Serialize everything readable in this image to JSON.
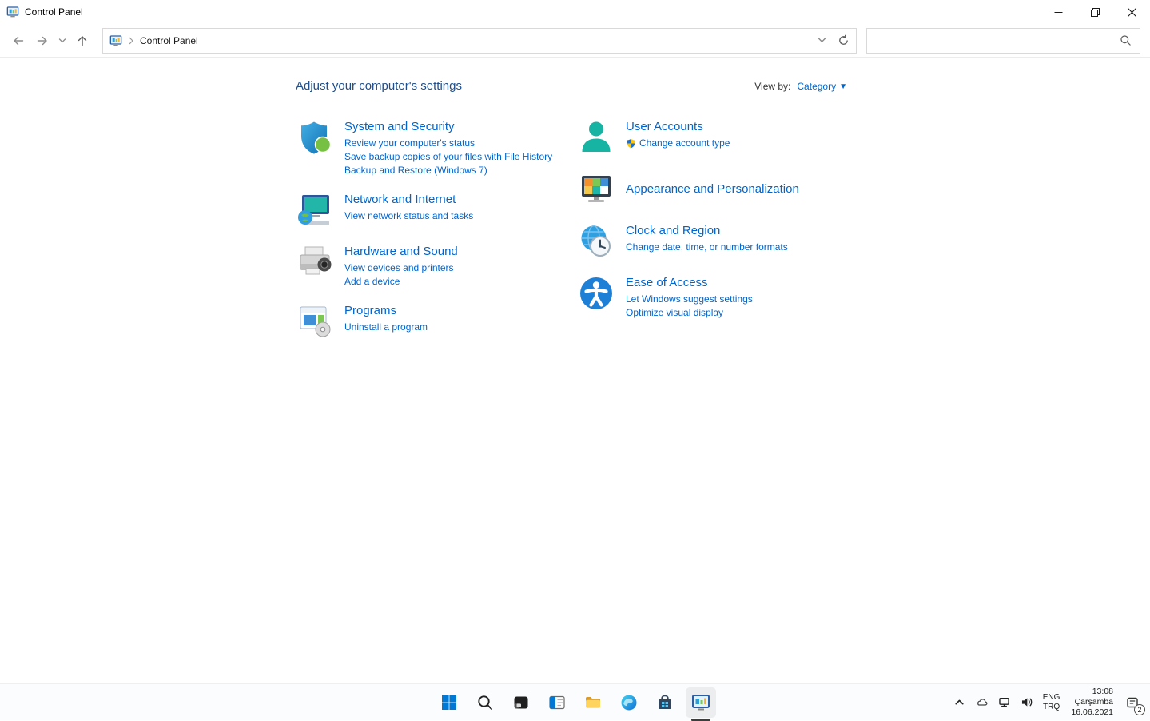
{
  "colors": {
    "heading_blue": "#1e4e8c",
    "link_blue": "#0066cc",
    "accent_blue": "#0078d4"
  },
  "window": {
    "title": "Control Panel"
  },
  "navbar": {
    "address": {
      "crumb": "Control Panel"
    },
    "search": {
      "value": "",
      "placeholder": ""
    }
  },
  "main": {
    "heading": "Adjust your computer's settings",
    "view_by": {
      "label": "View by:",
      "value": "Category"
    },
    "left": [
      {
        "title": "System and Security",
        "icon": "system-security-shield-icon",
        "links": [
          "Review your computer's status",
          "Save backup copies of your files with File History",
          "Backup and Restore (Windows 7)"
        ]
      },
      {
        "title": "Network and Internet",
        "icon": "network-internet-icon",
        "links": [
          "View network status and tasks"
        ]
      },
      {
        "title": "Hardware and Sound",
        "icon": "hardware-sound-printer-icon",
        "links": [
          "View devices and printers",
          "Add a device"
        ]
      },
      {
        "title": "Programs",
        "icon": "programs-icon",
        "links": [
          "Uninstall a program"
        ]
      }
    ],
    "right": [
      {
        "title": "User Accounts",
        "icon": "user-accounts-icon",
        "links": [
          "Change account type"
        ]
      },
      {
        "title": "Appearance and Personalization",
        "icon": "appearance-personalization-icon",
        "links": []
      },
      {
        "title": "Clock and Region",
        "icon": "clock-region-icon",
        "links": [
          "Change date, time, or number formats"
        ]
      },
      {
        "title": "Ease of Access",
        "icon": "ease-of-access-icon",
        "links": [
          "Let Windows suggest settings",
          "Optimize visual display"
        ]
      }
    ]
  },
  "taskbar": {
    "icons": [
      "start",
      "search",
      "task-view",
      "widgets",
      "file-explorer",
      "edge",
      "store",
      "control-panel"
    ],
    "active_app": "control-panel",
    "tray": {
      "icons": [
        "chevron-up",
        "onedrive-cloud",
        "network",
        "volume",
        "notification"
      ],
      "language": {
        "line1": "ENG",
        "line2": "TRQ"
      },
      "clock": {
        "time": "13:08",
        "day": "Çarşamba",
        "date": "16.06.2021"
      },
      "notification_badge": "2"
    }
  }
}
